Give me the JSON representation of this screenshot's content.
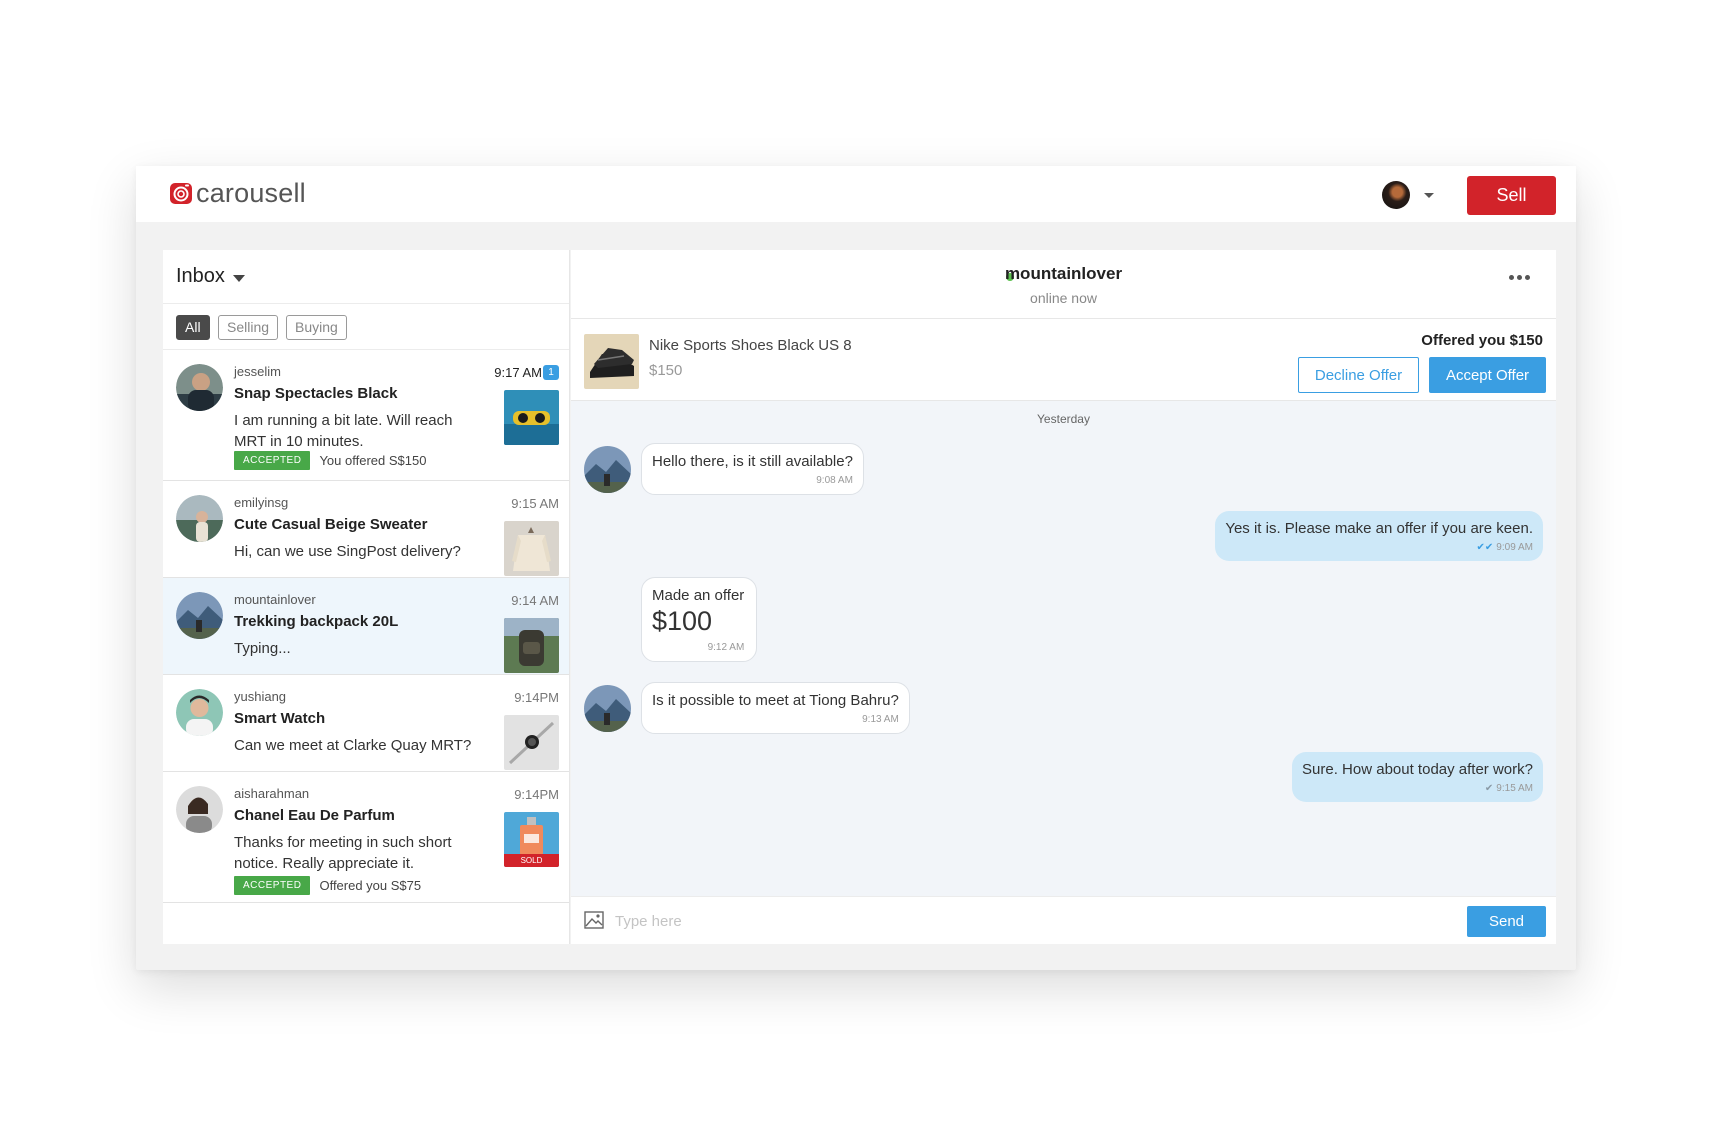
{
  "brand": {
    "name": "carousell",
    "accent": "#d2232a",
    "link_blue": "#3a9ee2"
  },
  "topbar": {
    "sell_label": "Sell",
    "avatar_icon": "user-avatar",
    "menu_icon": "caret-down-icon"
  },
  "inbox": {
    "title": "Inbox",
    "filters": [
      "All",
      "Selling",
      "Buying"
    ],
    "active_filter": "All",
    "conversations": [
      {
        "username": "jesselim",
        "product": "Snap Spectacles Black",
        "message": "I am running a bit late. Will reach MRT in 10 minutes.",
        "time": "9:17 AM",
        "unread": "1",
        "badge": "ACCEPTED",
        "status_text": "You offered S$150"
      },
      {
        "username": "emilyinsg",
        "product": "Cute Casual Beige Sweater",
        "message": "Hi, can we use SingPost delivery?",
        "time": "9:15 AM"
      },
      {
        "username": "mountainlover",
        "product": "Trekking backpack 20L",
        "message": "Typing...",
        "time": "9:14 AM",
        "selected": true
      },
      {
        "username": "yushiang",
        "product": "Smart Watch",
        "message": "Can we meet at Clarke Quay MRT?",
        "time": "9:14PM"
      },
      {
        "username": "aisharahman",
        "product": "Chanel Eau De Parfum",
        "message": "Thanks for meeting in such short notice. Really appreciate it.",
        "time": "9:14PM",
        "sold_label": "SOLD",
        "badge": "ACCEPTED",
        "status_text": "Offered you S$75"
      }
    ]
  },
  "chat": {
    "name": "mountainlover",
    "status": "online now",
    "listing": {
      "title": "Nike Sports Shoes Black US 8",
      "price": "$150"
    },
    "offer_label": "Offered you $150",
    "decline_label": "Decline Offer",
    "accept_label": "Accept Offer",
    "day_separator": "Yesterday",
    "messages": [
      {
        "dir": "in",
        "text": "Hello there, is it still available?",
        "time": "9:08 AM"
      },
      {
        "dir": "out",
        "text": "Yes it is. Please make an offer if you are keen.",
        "time": "9:09 AM"
      },
      {
        "dir": "in",
        "text": "Made an offer",
        "amount": "$100",
        "time": "9:12 AM"
      },
      {
        "dir": "in",
        "text": "Is it possible to meet at Tiong Bahru?",
        "time": "9:13 AM"
      },
      {
        "dir": "out",
        "text": "Sure. How about today after work?",
        "time": "9:15 AM"
      }
    ],
    "input_placeholder": "Type here",
    "send_label": "Send"
  }
}
